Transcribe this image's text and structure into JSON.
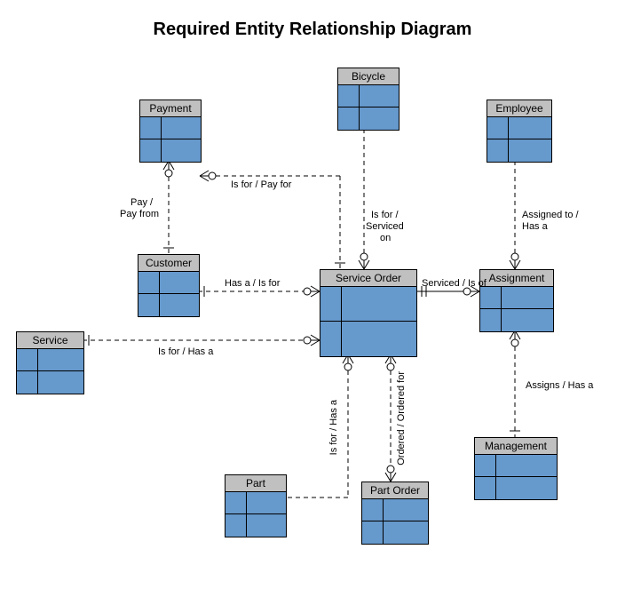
{
  "title": "Required Entity Relationship Diagram",
  "entities": {
    "bicycle": "Bicycle",
    "payment": "Payment",
    "employee": "Employee",
    "customer": "Customer",
    "service_order": "Service Order",
    "assignment": "Assignment",
    "service": "Service",
    "part": "Part",
    "part_order": "Part Order",
    "management": "Management"
  },
  "labels": {
    "payment_serviceorder": "Is for / Pay for",
    "payment_customer_1": "Pay /",
    "payment_customer_2": "Pay from",
    "bicycle_serviceorder_1": "Is for /",
    "bicycle_serviceorder_2": "Serviced",
    "bicycle_serviceorder_3": "on",
    "employee_assignment_1": "Assigned to /",
    "employee_assignment_2": "Has a",
    "customer_serviceorder": "Has a / Is for",
    "serviceorder_assignment": "Serviced / Is of",
    "service_serviceorder": "Is for / Has a",
    "assignment_management": "Assigns / Has a",
    "part_serviceorder": "Is for / Has a",
    "partorder_serviceorder": "Ordered / Ordered for"
  },
  "chart_data": {
    "type": "diagram",
    "title": "Required Entity Relationship Diagram",
    "diagram_type": "entity-relationship",
    "entities": [
      "Bicycle",
      "Payment",
      "Employee",
      "Customer",
      "Service Order",
      "Assignment",
      "Service",
      "Part",
      "Part Order",
      "Management"
    ],
    "relationships": [
      {
        "from": "Payment",
        "to": "Service Order",
        "label": "Is for / Pay for",
        "style": "dashed"
      },
      {
        "from": "Payment",
        "to": "Customer",
        "label": "Pay / Pay from",
        "style": "dashed"
      },
      {
        "from": "Bicycle",
        "to": "Service Order",
        "label": "Is for / Serviced on",
        "style": "dashed"
      },
      {
        "from": "Employee",
        "to": "Assignment",
        "label": "Assigned to / Has a",
        "style": "dashed"
      },
      {
        "from": "Customer",
        "to": "Service Order",
        "label": "Has a / Is for",
        "style": "dashed"
      },
      {
        "from": "Service Order",
        "to": "Assignment",
        "label": "Serviced / Is of",
        "style": "solid"
      },
      {
        "from": "Service",
        "to": "Service Order",
        "label": "Is for / Has a",
        "style": "dashed"
      },
      {
        "from": "Assignment",
        "to": "Management",
        "label": "Assigns / Has a",
        "style": "dashed"
      },
      {
        "from": "Part",
        "to": "Service Order",
        "label": "Is for / Has a",
        "style": "dashed"
      },
      {
        "from": "Part Order",
        "to": "Service Order",
        "label": "Ordered / Ordered for",
        "style": "dashed"
      }
    ]
  }
}
